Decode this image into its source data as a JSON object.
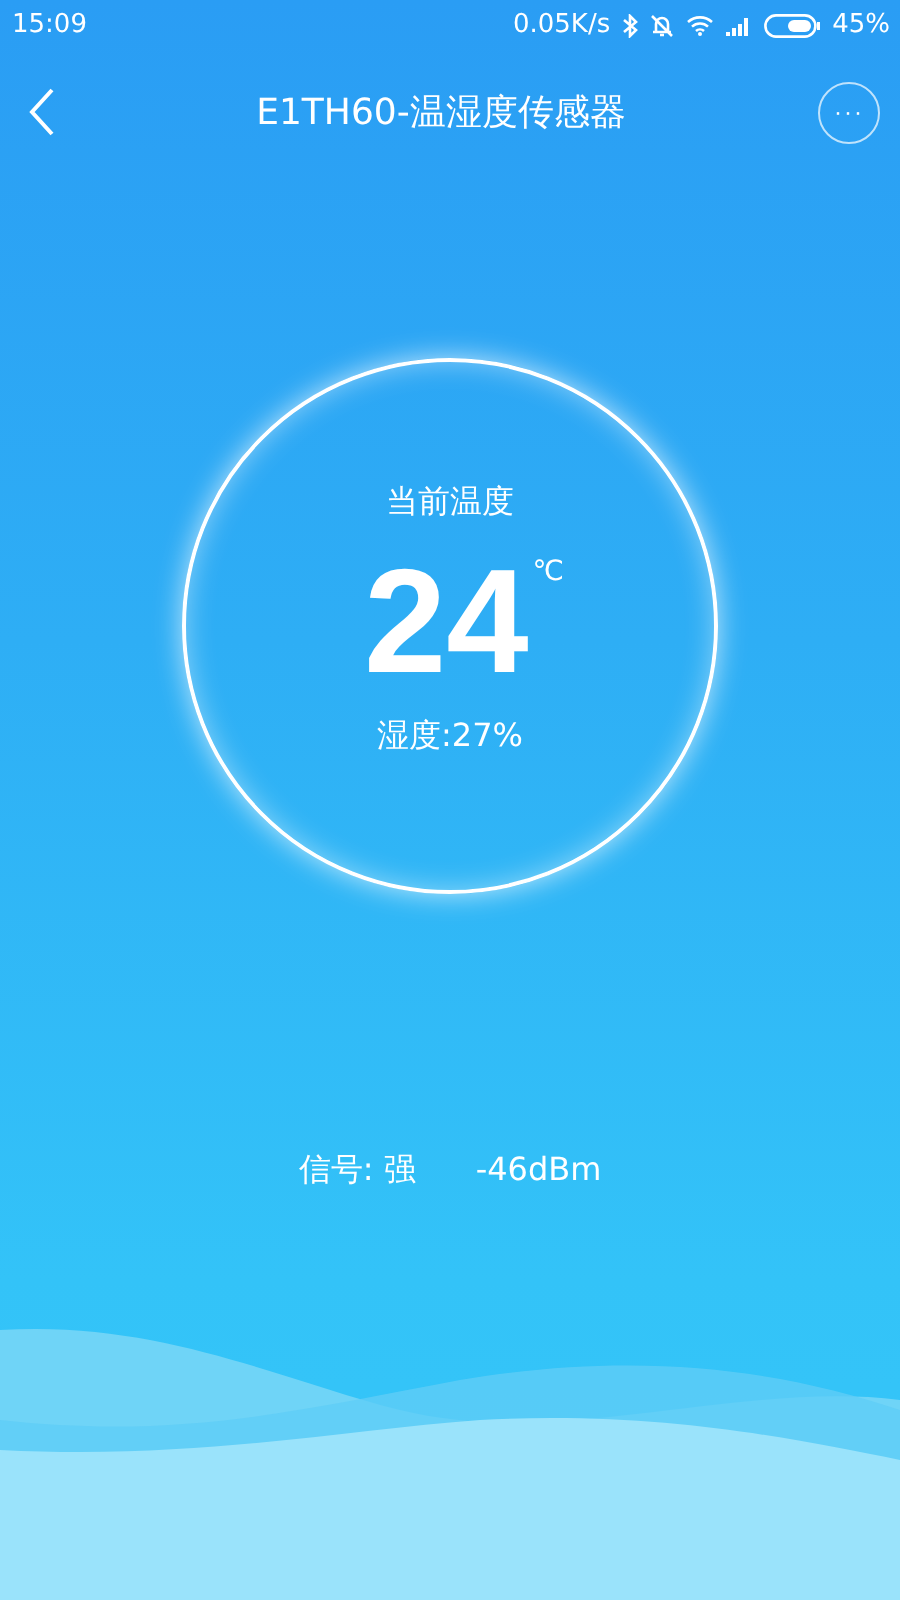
{
  "status_bar": {
    "time": "15:09",
    "speed": "0.05K/s",
    "battery": "45%"
  },
  "header": {
    "title": "E1TH60-温湿度传感器",
    "more": "···"
  },
  "gauge": {
    "label": "当前温度",
    "temperature": "24",
    "unit": "℃",
    "humidity": "湿度:27%"
  },
  "signal": {
    "strength": "信号: 强",
    "reading": "-46dBm"
  }
}
